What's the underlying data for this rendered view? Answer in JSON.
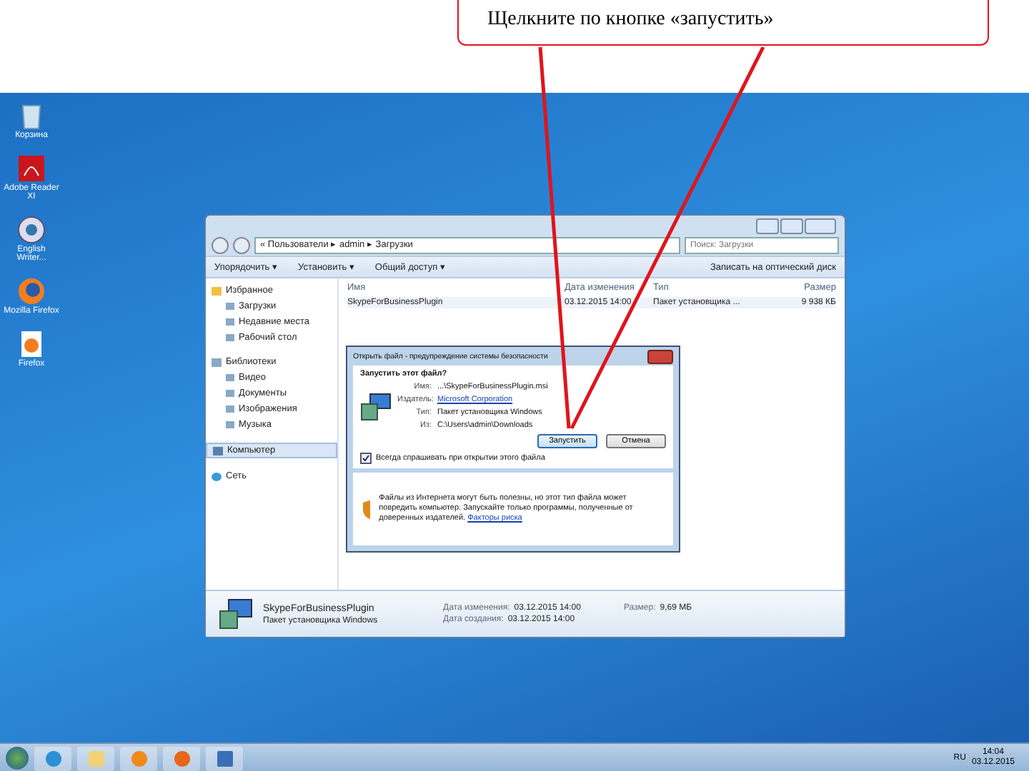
{
  "callout": {
    "text": "Щелкните по кнопке «запустить»"
  },
  "desktop_icons": [
    {
      "label": "Корзина",
      "kind": "bin"
    },
    {
      "label": "Adobe Reader XI",
      "kind": "pdf"
    },
    {
      "label": "English Writer...",
      "kind": "app"
    },
    {
      "label": "Mozilla Firefox",
      "kind": "fox"
    },
    {
      "label": "Firefox",
      "kind": "file"
    }
  ],
  "explorer": {
    "address": "« Пользователи ▸ admin ▸ Загрузки",
    "search": {
      "placeholder": "Поиск: Загрузки"
    },
    "toolbar": [
      "Упорядочить ▾",
      "Установить ▾",
      "Общий доступ ▾",
      "Записать на оптический диск"
    ],
    "sidebar": [
      {
        "label": "Избранное",
        "kind": "star",
        "selected": false,
        "children": [
          {
            "label": "Загрузки",
            "selected": false
          },
          {
            "label": "Недавние места",
            "selected": false
          },
          {
            "label": "Рабочий стол",
            "selected": false
          }
        ]
      },
      {
        "label": "Библиотеки",
        "kind": "lib",
        "selected": false,
        "children": [
          {
            "label": "Видео",
            "selected": false
          },
          {
            "label": "Документы",
            "selected": false
          },
          {
            "label": "Изображения",
            "selected": false
          },
          {
            "label": "Музыка",
            "selected": false
          }
        ]
      },
      {
        "label": "Компьютер",
        "kind": "pc",
        "selected": true
      },
      {
        "label": "Сеть",
        "kind": "net",
        "selected": false
      }
    ],
    "columns": [
      "Имя",
      "Дата изменения",
      "Тип",
      "Размер"
    ],
    "rows": [
      [
        "SkypeForBusinessPlugin",
        "03.12.2015 14:00",
        "Пакет установщика ...",
        "9 938 КБ"
      ]
    ],
    "details": {
      "name": "SkypeForBusinessPlugin",
      "type": "Пакет установщика Windows",
      "fields": [
        {
          "label": "Дата изменения:",
          "value": "03.12.2015 14:00"
        },
        {
          "label": "Размер:",
          "value": "9,69 МБ"
        },
        {
          "label": "Дата создания:",
          "value": "03.12.2015 14:00"
        }
      ]
    }
  },
  "dialog": {
    "title": "Открыть файл - предупреждение системы безопасности",
    "question": "Запустить этот файл?",
    "fields": [
      {
        "label": "Имя:",
        "value": "...\\SkypeForBusinessPlugin.msi",
        "kind": "text"
      },
      {
        "label": "Издатель:",
        "value": "Microsoft Corporation",
        "kind": "link"
      },
      {
        "label": "Тип:",
        "value": "Пакет установщика Windows",
        "kind": "text"
      },
      {
        "label": "Из:",
        "value": "C:\\Users\\admin\\Downloads",
        "kind": "text"
      }
    ],
    "buttons": [
      {
        "label": "Запустить",
        "selected": true
      },
      {
        "label": "Отмена",
        "selected": false
      }
    ],
    "checkbox": {
      "label": "Всегда спрашивать при открытии этого файла",
      "checked": true
    },
    "warning": "Файлы из Интернета могут быть полезны, но этот тип файла может повредить компьютер. Запускайте только программы, полученные от доверенных издателей.",
    "warning_link": "Факторы риска"
  },
  "taskbar": {
    "lang": "RU",
    "time": "14:04",
    "date": "03.12.2015"
  }
}
